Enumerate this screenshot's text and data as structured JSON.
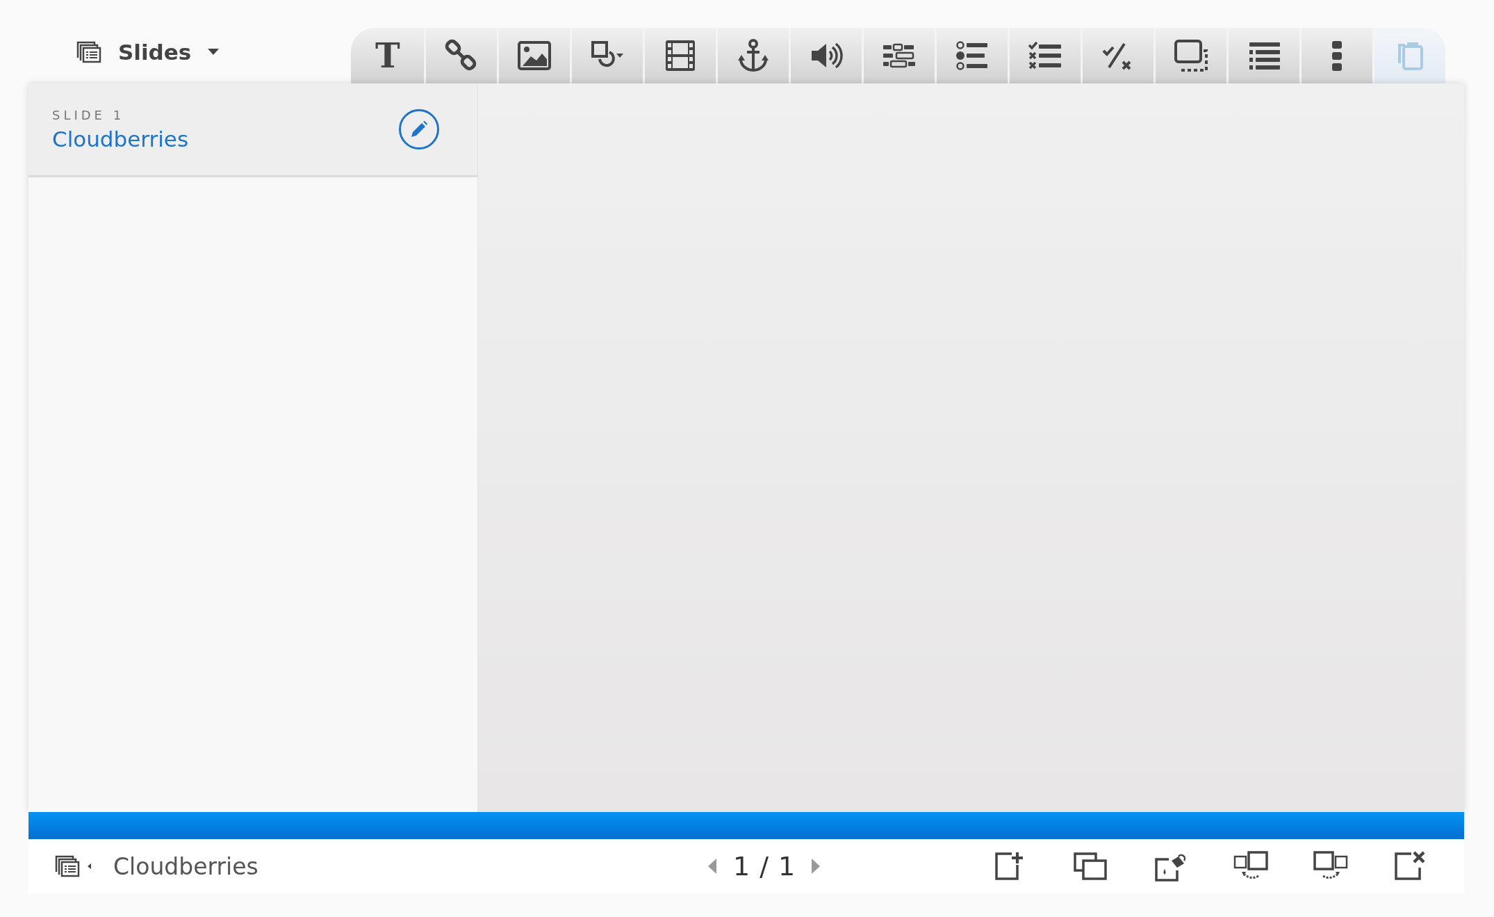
{
  "header": {
    "title": "Slides"
  },
  "toolbar": [
    {
      "kind": "text",
      "label": "T",
      "disabled": false
    },
    {
      "kind": "link",
      "disabled": false
    },
    {
      "kind": "image",
      "disabled": false
    },
    {
      "kind": "shape",
      "disabled": false
    },
    {
      "kind": "video",
      "disabled": false
    },
    {
      "kind": "anchor",
      "disabled": false
    },
    {
      "kind": "audio",
      "disabled": false
    },
    {
      "kind": "blocks",
      "disabled": false
    },
    {
      "kind": "radio",
      "disabled": false
    },
    {
      "kind": "checklist",
      "disabled": false
    },
    {
      "kind": "fraction",
      "disabled": false
    },
    {
      "kind": "hotspot",
      "disabled": false
    },
    {
      "kind": "list",
      "disabled": false
    },
    {
      "kind": "more",
      "disabled": false
    },
    {
      "kind": "paste",
      "disabled": true
    }
  ],
  "slides": [
    {
      "number": "SLIDE 1",
      "title": "Cloudberries"
    }
  ],
  "footer": {
    "current_title": "Cloudberries",
    "page": "1",
    "separator": "/",
    "total": "1",
    "actions": [
      {
        "kind": "add"
      },
      {
        "kind": "copy"
      },
      {
        "kind": "style"
      },
      {
        "kind": "move-left"
      },
      {
        "kind": "move-right"
      },
      {
        "kind": "delete"
      }
    ]
  }
}
